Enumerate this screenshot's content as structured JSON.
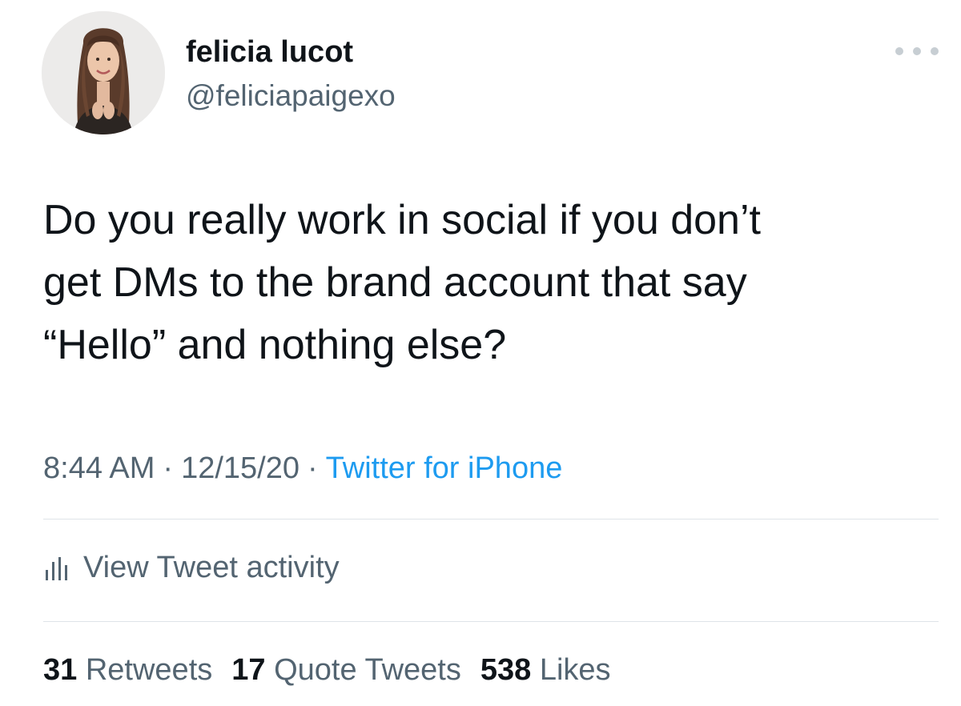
{
  "user": {
    "display_name": "felicia lucot",
    "handle": "@feliciapaigexo",
    "avatar_icon": "profile-photo"
  },
  "tweet": {
    "text_lines": [
      "Do you really work in social if you don’t",
      "get DMs to the brand account that say",
      "“Hello” and nothing else?"
    ],
    "time": "8:44 AM",
    "date": "12/15/20",
    "separator": "·",
    "source": "Twitter for iPhone"
  },
  "activity": {
    "label": "View Tweet activity",
    "icon": "bar-chart-icon"
  },
  "stats": {
    "retweets_count": "31",
    "retweets_label": "Retweets",
    "quote_tweets_count": "17",
    "quote_tweets_label": "Quote Tweets",
    "likes_count": "538",
    "likes_label": "Likes"
  },
  "colors": {
    "primary_text": "#0f1419",
    "secondary_text": "#536471",
    "link": "#1d9bf0",
    "divider": "#dfe4e8"
  }
}
